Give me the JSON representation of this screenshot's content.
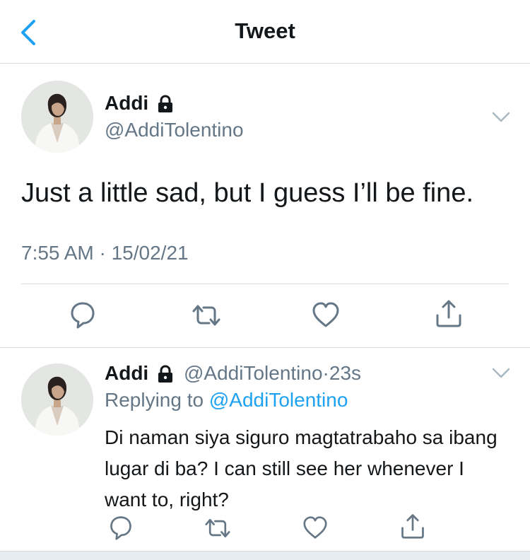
{
  "header": {
    "title": "Tweet",
    "back_icon": "chevron-left-icon"
  },
  "colors": {
    "accent": "#1da1f2",
    "secondary_text": "#657786",
    "divider": "#d6dbdf"
  },
  "main_tweet": {
    "author_name": "Addi",
    "handle": "@AddiTolentino",
    "protected_icon": "lock-icon",
    "text": "Just a little sad, but I guess I’ll be fine.",
    "timestamp": "7:55 AM · 15/02/21",
    "actions": [
      "reply-icon",
      "retweet-icon",
      "like-icon",
      "share-icon"
    ]
  },
  "reply_tweet": {
    "author_name": "Addi",
    "handle": "@AddiTolentino",
    "separator": "·",
    "age": "23s",
    "replying_prefix": "Replying to",
    "replying_to": "@AddiTolentino",
    "text": "Di naman siya siguro magtatrabaho sa ibang lugar di ba? I can still see her whenever I want to, right?",
    "actions": [
      "reply-icon",
      "retweet-icon",
      "like-icon",
      "share-icon"
    ]
  }
}
